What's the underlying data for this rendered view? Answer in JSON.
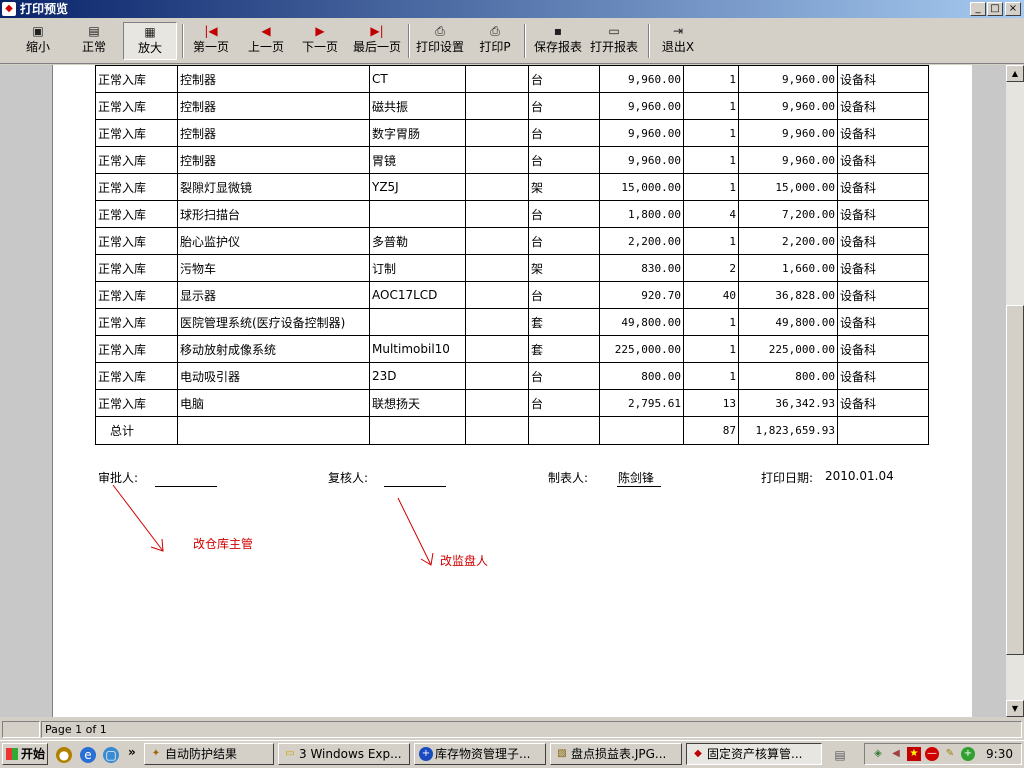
{
  "window": {
    "title": "打印预览",
    "controls": [
      "_",
      "□",
      "×"
    ]
  },
  "toolbar": {
    "zoom_out": "缩小",
    "normal": "正常",
    "zoom_in": "放大",
    "first_page": "第一页",
    "prev_page": "上一页",
    "next_page": "下一页",
    "last_page": "最后一页",
    "print_setup": "打印设置",
    "print": "打印P",
    "save_report": "保存报表",
    "open_report": "打开报表",
    "exit": "退出X"
  },
  "report": {
    "rows": [
      [
        "正常入库",
        "控制器",
        "CT",
        "",
        "台",
        "9,960.00",
        "1",
        "9,960.00",
        "设备科"
      ],
      [
        "正常入库",
        "控制器",
        "磁共振",
        "",
        "台",
        "9,960.00",
        "1",
        "9,960.00",
        "设备科"
      ],
      [
        "正常入库",
        "控制器",
        "数字胃肠",
        "",
        "台",
        "9,960.00",
        "1",
        "9,960.00",
        "设备科"
      ],
      [
        "正常入库",
        "控制器",
        "胃镜",
        "",
        "台",
        "9,960.00",
        "1",
        "9,960.00",
        "设备科"
      ],
      [
        "正常入库",
        "裂隙灯显微镜",
        "YZ5J",
        "",
        "架",
        "15,000.00",
        "1",
        "15,000.00",
        "设备科"
      ],
      [
        "正常入库",
        "球形扫描台",
        "",
        "",
        "台",
        "1,800.00",
        "4",
        "7,200.00",
        "设备科"
      ],
      [
        "正常入库",
        "胎心监护仪",
        "多普勒",
        "",
        "台",
        "2,200.00",
        "1",
        "2,200.00",
        "设备科"
      ],
      [
        "正常入库",
        "污物车",
        "订制",
        "",
        "架",
        "830.00",
        "2",
        "1,660.00",
        "设备科"
      ],
      [
        "正常入库",
        "显示器",
        "AOC17LCD",
        "",
        "台",
        "920.70",
        "40",
        "36,828.00",
        "设备科"
      ],
      [
        "正常入库",
        "医院管理系统(医疗设备控制器)",
        "",
        "",
        "套",
        "49,800.00",
        "1",
        "49,800.00",
        "设备科"
      ],
      [
        "正常入库",
        "移动放射成像系统",
        "Multimobil10",
        "",
        "套",
        "225,000.00",
        "1",
        "225,000.00",
        "设备科"
      ],
      [
        "正常入库",
        "电动吸引器",
        "23D",
        "",
        "台",
        "800.00",
        "1",
        "800.00",
        "设备科"
      ],
      [
        "正常入库",
        "电脑",
        "联想扬天",
        "",
        "台",
        "2,795.61",
        "13",
        "36,342.93",
        "设备科"
      ]
    ],
    "total": {
      "label": "总计",
      "qty": "87",
      "amount": "1,823,659.93"
    },
    "signatures": {
      "approver_label": "审批人:",
      "reviewer_label": "复核人:",
      "preparer_label": "制表人:",
      "preparer_name": "陈剑锋",
      "print_date_label": "打印日期:",
      "print_date": "2010.01.04"
    },
    "annotations": {
      "note1": "改仓库主管",
      "note2": "改监盘人"
    }
  },
  "status": {
    "page_info": "Page 1 of 1"
  },
  "taskbar": {
    "start": "开始",
    "tasks": [
      "自动防护结果",
      "3 Windows Exp...",
      "库存物资管理子...",
      "盘点损益表.JPG...",
      "固定资产核算管..."
    ],
    "overflow": "»",
    "clock": "9:30"
  },
  "colors": {
    "annotation": "#d00000",
    "titlebar_start": "#0a246a",
    "titlebar_end": "#a6caf0"
  }
}
